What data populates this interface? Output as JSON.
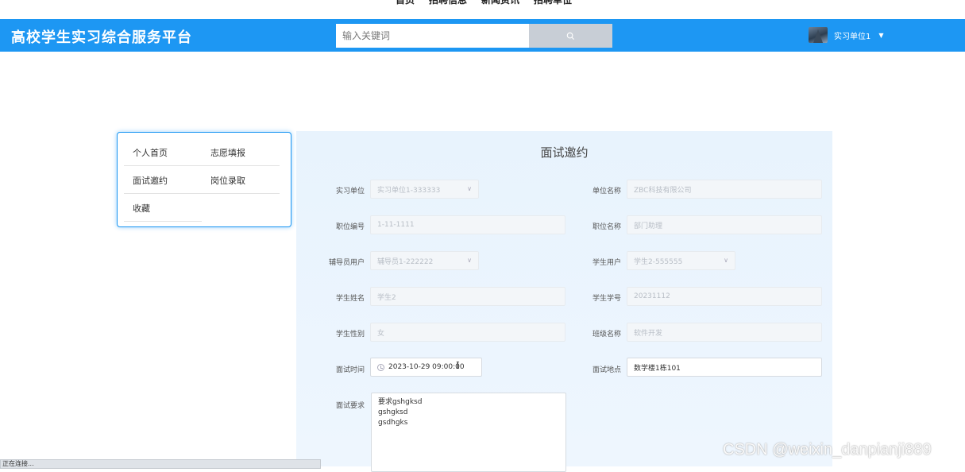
{
  "top_nav": [
    "首页",
    "招聘信息",
    "新闻资讯",
    "招聘单位"
  ],
  "header": {
    "brand": "高校学生实习综合服务平台",
    "search_placeholder": "输入关键词",
    "user_name": "实习单位1"
  },
  "side_menu": {
    "items": [
      "个人首页",
      "志愿填报",
      "面试邀约",
      "岗位录取",
      "收藏"
    ]
  },
  "form": {
    "title": "面试邀约",
    "fields": {
      "company": {
        "label": "实习单位",
        "value": "实习单位1-333333"
      },
      "company_name": {
        "label": "单位名称",
        "value": "ZBC科技有限公司"
      },
      "position_no": {
        "label": "职位编号",
        "value": "1-11-1111"
      },
      "position_name": {
        "label": "职位名称",
        "value": "部门助理"
      },
      "tutor": {
        "label": "辅导员用户",
        "value": "辅导员1-222222"
      },
      "student_user": {
        "label": "学生用户",
        "value": "学生2-555555"
      },
      "student_name": {
        "label": "学生姓名",
        "value": "学生2"
      },
      "student_no": {
        "label": "学生学号",
        "value": "20231112"
      },
      "gender": {
        "label": "学生性别",
        "value": "女"
      },
      "class_name": {
        "label": "班级名称",
        "value": "软件开发"
      },
      "interview_time": {
        "label": "面试时间",
        "value": "2023-10-29 09:00:00"
      },
      "interview_place": {
        "label": "面试地点",
        "value": "数学楼1栋101"
      },
      "requirements": {
        "label": "面试要求",
        "value": "要求gshgksd\ngshgksd\ngsdhgks"
      }
    }
  },
  "watermark": "CSDN @weixin_danpianji889",
  "status_text": "正在连接..."
}
